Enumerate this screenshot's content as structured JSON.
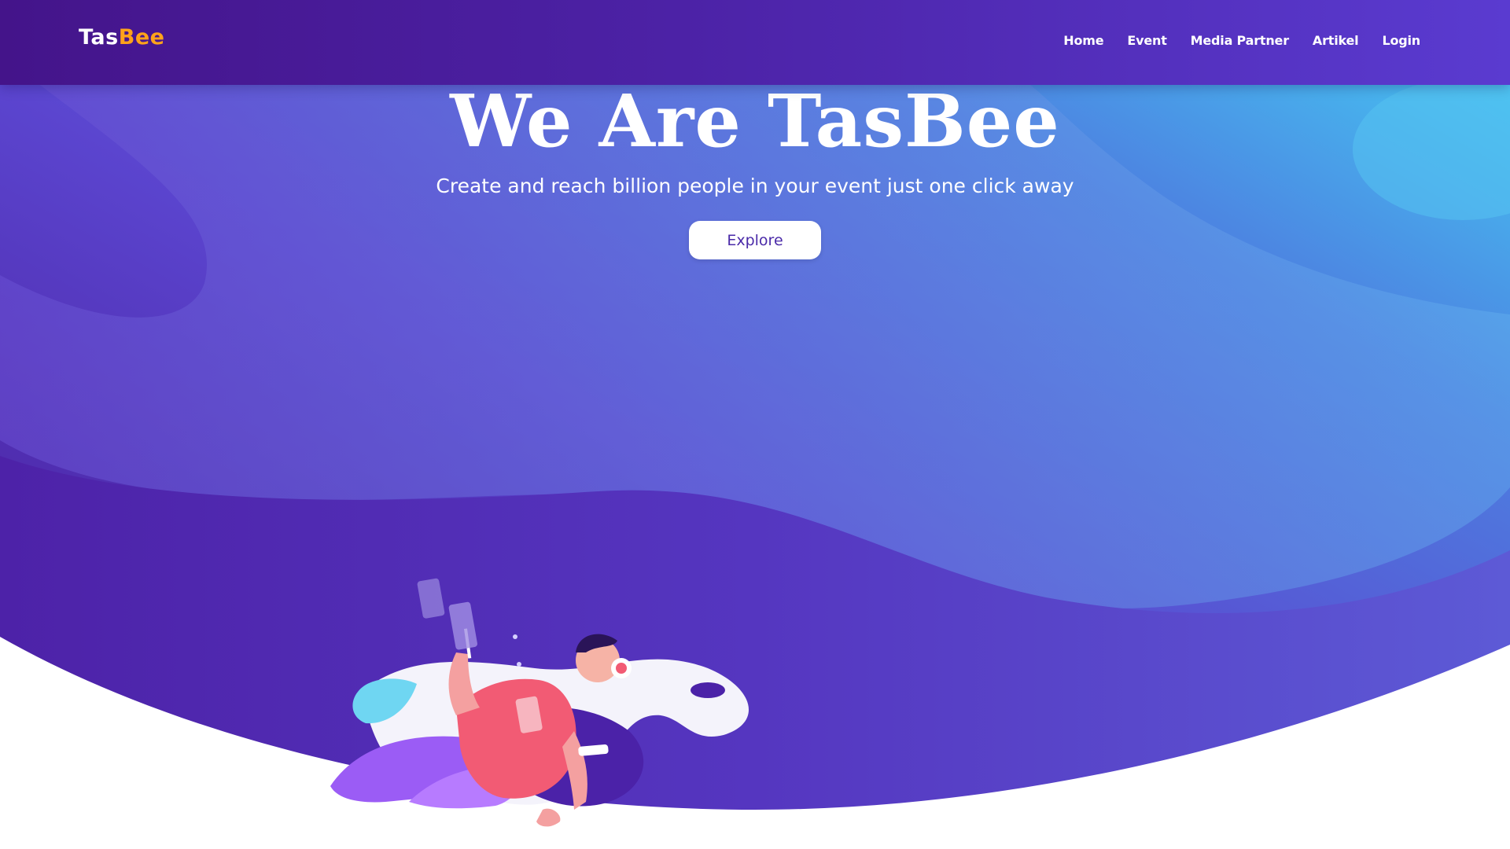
{
  "brand": {
    "part1": "Tas",
    "part2": "Bee",
    "color_primary": "#ffffff",
    "color_accent": "#ffa31a"
  },
  "nav": {
    "items": [
      {
        "label": "Home"
      },
      {
        "label": "Event"
      },
      {
        "label": "Media Partner"
      },
      {
        "label": "Artikel"
      },
      {
        "label": "Login"
      }
    ]
  },
  "hero": {
    "title": "We Are TasBee",
    "subtitle": "Create and reach billion people in your event just one click away",
    "cta_label": "Explore",
    "gradient_start": "#4a18a0",
    "gradient_end": "#46d0f4"
  },
  "illustration": {
    "icon": "person-with-headphones-illustration"
  }
}
